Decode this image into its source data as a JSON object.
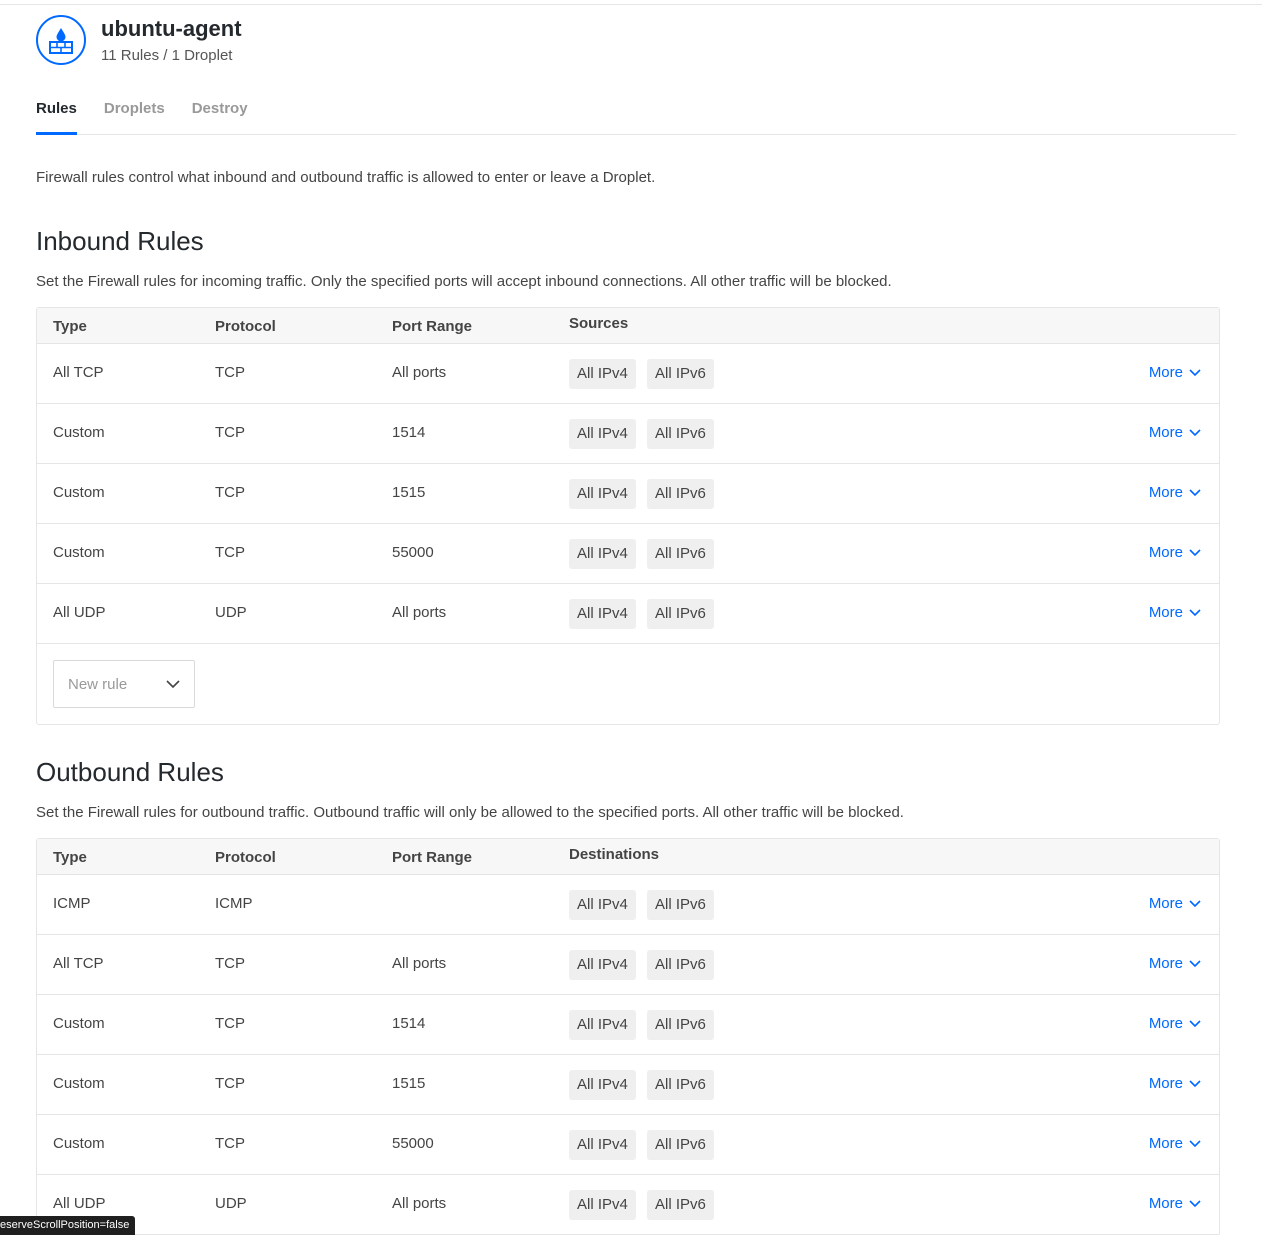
{
  "header": {
    "title": "ubuntu-agent",
    "subtitle": "11 Rules / 1 Droplet",
    "icon": "firewall-icon",
    "accent": "#0069ff"
  },
  "tabs": [
    {
      "label": "Rules",
      "active": true
    },
    {
      "label": "Droplets",
      "active": false
    },
    {
      "label": "Destroy",
      "active": false
    }
  ],
  "intro": "Firewall rules control what inbound and outbound traffic is allowed to enter or leave a Droplet.",
  "inbound": {
    "title": "Inbound Rules",
    "description": "Set the Firewall rules for incoming traffic. Only the specified ports will accept inbound connections. All other traffic will be blocked.",
    "columns": [
      "Type",
      "Protocol",
      "Port Range",
      "Sources"
    ],
    "rows": [
      {
        "type": "All TCP",
        "protocol": "TCP",
        "port": "All ports",
        "tags": [
          "All IPv4",
          "All IPv6"
        ],
        "more": "More"
      },
      {
        "type": "Custom",
        "protocol": "TCP",
        "port": "1514",
        "tags": [
          "All IPv4",
          "All IPv6"
        ],
        "more": "More"
      },
      {
        "type": "Custom",
        "protocol": "TCP",
        "port": "1515",
        "tags": [
          "All IPv4",
          "All IPv6"
        ],
        "more": "More"
      },
      {
        "type": "Custom",
        "protocol": "TCP",
        "port": "55000",
        "tags": [
          "All IPv4",
          "All IPv6"
        ],
        "more": "More"
      },
      {
        "type": "All UDP",
        "protocol": "UDP",
        "port": "All ports",
        "tags": [
          "All IPv4",
          "All IPv6"
        ],
        "more": "More"
      }
    ],
    "new_rule": "New rule"
  },
  "outbound": {
    "title": "Outbound Rules",
    "description": "Set the Firewall rules for outbound traffic. Outbound traffic will only be allowed to the specified ports. All other traffic will be blocked.",
    "columns": [
      "Type",
      "Protocol",
      "Port Range",
      "Destinations"
    ],
    "rows": [
      {
        "type": "ICMP",
        "protocol": "ICMP",
        "port": "",
        "tags": [
          "All IPv4",
          "All IPv6"
        ],
        "more": "More"
      },
      {
        "type": "All TCP",
        "protocol": "TCP",
        "port": "All ports",
        "tags": [
          "All IPv4",
          "All IPv6"
        ],
        "more": "More"
      },
      {
        "type": "Custom",
        "protocol": "TCP",
        "port": "1514",
        "tags": [
          "All IPv4",
          "All IPv6"
        ],
        "more": "More"
      },
      {
        "type": "Custom",
        "protocol": "TCP",
        "port": "1515",
        "tags": [
          "All IPv4",
          "All IPv6"
        ],
        "more": "More"
      },
      {
        "type": "Custom",
        "protocol": "TCP",
        "port": "55000",
        "tags": [
          "All IPv4",
          "All IPv6"
        ],
        "more": "More"
      },
      {
        "type": "All UDP",
        "protocol": "UDP",
        "port": "All ports",
        "tags": [
          "All IPv4",
          "All IPv6"
        ],
        "more": "More"
      }
    ]
  },
  "status_bar": "eserveScrollPosition=false"
}
